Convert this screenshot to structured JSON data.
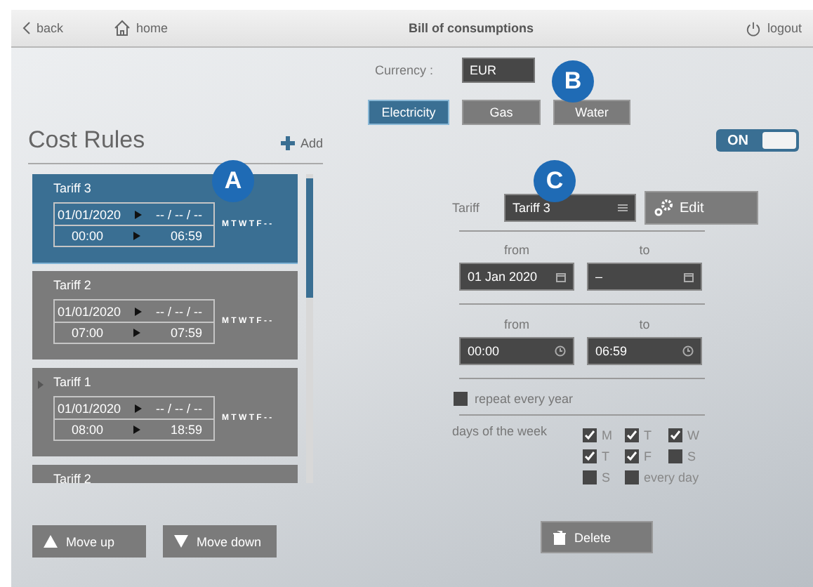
{
  "header": {
    "back": "back",
    "home": "home",
    "title": "Bill of consumptions",
    "logout": "logout"
  },
  "annotations": [
    {
      "letter": "A",
      "kind": "list"
    },
    {
      "letter": "B",
      "kind": "currency"
    },
    {
      "letter": "C",
      "kind": "form"
    }
  ],
  "cost_rules": {
    "title": "Cost Rules",
    "add": "Add",
    "tariffs": [
      {
        "name": "Tariff 3",
        "date_from": "01/01/2020",
        "date_to": "-- / -- / --",
        "time_from": "00:00",
        "time_to": "06:59",
        "days": "M T W T F - -",
        "selected": true,
        "current": false
      },
      {
        "name": "Tariff 2",
        "date_from": "01/01/2020",
        "date_to": "-- / -- / --",
        "time_from": "07:00",
        "time_to": "07:59",
        "days": "M T W T F - -",
        "selected": false,
        "current": false
      },
      {
        "name": "Tariff 1",
        "date_from": "01/01/2020",
        "date_to": "-- / -- / --",
        "time_from": "08:00",
        "time_to": "18:59",
        "days": "M T W T F - -",
        "selected": false,
        "current": true
      },
      {
        "name": "Tariff 2",
        "selected": false,
        "current": false
      }
    ],
    "move_up": "Move up",
    "move_down": "Move down"
  },
  "currency": {
    "label": "Currency :",
    "value": "EUR"
  },
  "tabs": [
    {
      "label": "Electricity",
      "selected": true
    },
    {
      "label": "Gas",
      "selected": false
    },
    {
      "label": "Water",
      "selected": false
    }
  ],
  "toggle": {
    "label": "ON",
    "on": true
  },
  "form": {
    "tariff_label": "Tariff",
    "tariff_value": "Tariff 3",
    "edit": "Edit",
    "date_from_label": "from",
    "date_to_label": "to",
    "date_from": "01 Jan 2020",
    "date_to": "–",
    "time_from_label": "from",
    "time_to_label": "to",
    "time_from": "00:00",
    "time_to": "06:59",
    "repeat": {
      "label": "repeat every year",
      "checked": false
    },
    "days_label": "days of the week",
    "days": [
      {
        "label": "M",
        "checked": true
      },
      {
        "label": "T",
        "checked": true
      },
      {
        "label": "W",
        "checked": true
      },
      {
        "label": "T",
        "checked": true
      },
      {
        "label": "F",
        "checked": true
      },
      {
        "label": "S",
        "checked": false
      },
      {
        "label": "S",
        "checked": false
      },
      {
        "label": "every day",
        "checked": false
      }
    ],
    "delete": "Delete"
  }
}
